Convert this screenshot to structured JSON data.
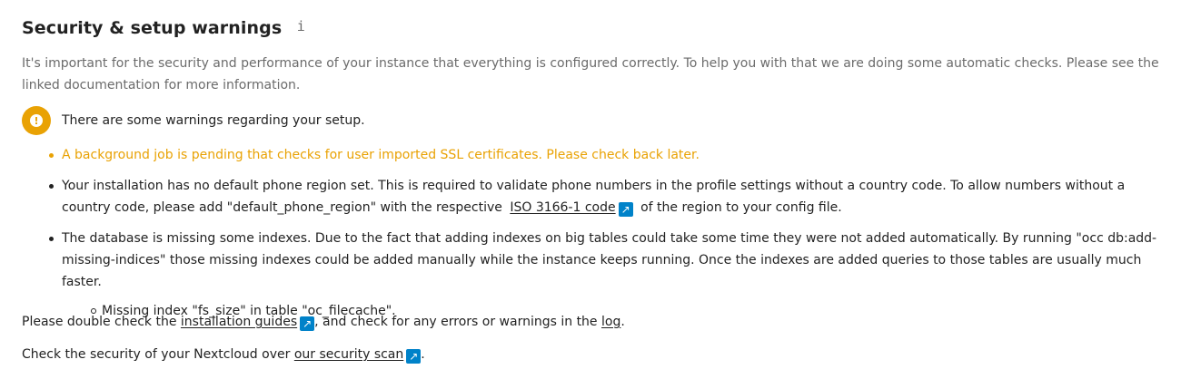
{
  "header": {
    "title": "Security & setup warnings",
    "info_icon": "i"
  },
  "description": "It's important for the security and performance of your instance that everything is configured correctly. To help you with that we are doing some automatic checks. Please see the linked documentation for more information.",
  "status": {
    "icon": "warning-icon",
    "icon_glyph": "!",
    "text": "There are some warnings regarding your setup.",
    "color": "#e9a204"
  },
  "issues": {
    "background_job": "A background job is pending that checks for user imported SSL certificates. Please check back later.",
    "phone_region": {
      "before": "Your installation has no default phone region set. This is required to validate phone numbers in the profile settings without a country code. To allow numbers without a country code, please add \"default_phone_region\" with the respective",
      "link": "ISO 3166-1 code",
      "after": "of the region to your config file."
    },
    "indexes": {
      "text": "The database is missing some indexes. Due to the fact that adding indexes on big tables could take some time they were not added automatically. By running \"occ db:add-missing-indices\" those missing indexes could be added manually while the instance keeps running. Once the indexes are added queries to those tables are usually much faster.",
      "sub_items": [
        "Missing index \"fs_size\" in table \"oc_filecache\"."
      ]
    }
  },
  "footer": {
    "line1": {
      "before": "Please double check the",
      "guides_link": "installation guides",
      "middle": ", and check for any errors or warnings in the",
      "log_link": "log",
      "after": "."
    },
    "line2": {
      "before": "Check the security of your Nextcloud over",
      "scan_link": "our security scan",
      "after": "."
    }
  },
  "icons": {
    "external_link": "↗"
  },
  "colors": {
    "warning": "#e9a204",
    "link_icon": "#0082c9",
    "text": "#222222",
    "muted": "#6b6b6b"
  }
}
